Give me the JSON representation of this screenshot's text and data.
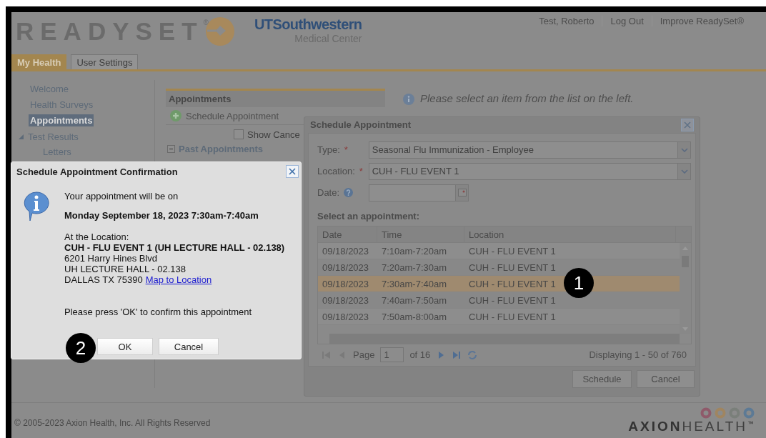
{
  "header": {
    "logo_text": "READYSET",
    "logo_mark": "®",
    "partner_name": "UTSouthwestern",
    "partner_sub": "Medical Center",
    "user_links": [
      "Test, Roberto",
      "Log Out",
      "Improve ReadySet®"
    ]
  },
  "tabs": [
    {
      "label": "My Health",
      "selected": true
    },
    {
      "label": "User Settings",
      "selected": false
    }
  ],
  "sidebar": {
    "items": [
      {
        "label": "Welcome",
        "selected": false
      },
      {
        "label": "Health Surveys",
        "selected": false
      },
      {
        "label": "Appointments",
        "selected": true
      },
      {
        "label": "Test Results",
        "selected": false,
        "expanded": true,
        "children": [
          {
            "label": "Letters",
            "selected": false
          }
        ]
      }
    ]
  },
  "appointments_panel": {
    "title": "Appointments",
    "action": "Schedule Appointment",
    "show_cancelled": {
      "label": "Show Cance",
      "checked": false
    },
    "section": {
      "label": "Past Appointments",
      "expanded": true
    }
  },
  "info_message": "Please select an item from the list on the left.",
  "schedule_dialog": {
    "title": "Schedule Appointment",
    "fields": [
      {
        "label": "Type:",
        "required_mark": "*",
        "kind": "select",
        "value": "Seasonal Flu Immunization - Employee"
      },
      {
        "label": "Location:",
        "required_mark": "*",
        "kind": "select",
        "value": "CUH - FLU EVENT 1"
      },
      {
        "label": "Date:",
        "kind": "date",
        "help": true
      }
    ],
    "grid_title": "Select an appointment:",
    "columns": [
      "Date",
      "Time",
      "Location"
    ],
    "rows": [
      {
        "cells": [
          "09/18/2023",
          "7:10am-7:20am",
          "CUH - FLU EVENT 1"
        ],
        "selected": false
      },
      {
        "cells": [
          "09/18/2023",
          "7:20am-7:30am",
          "CUH - FLU EVENT 1"
        ],
        "selected": false
      },
      {
        "cells": [
          "09/18/2023",
          "7:30am-7:40am",
          "CUH - FLU EVENT 1"
        ],
        "selected": true
      },
      {
        "cells": [
          "09/18/2023",
          "7:40am-7:50am",
          "CUH - FLU EVENT 1"
        ],
        "selected": false
      },
      {
        "cells": [
          "09/18/2023",
          "7:50am-8:00am",
          "CUH - FLU EVENT 1"
        ],
        "selected": false
      }
    ],
    "pager": {
      "page_label": "Page",
      "page": "1",
      "of": "of 16",
      "display": "Displaying 1 - 50 of 760"
    },
    "buttons": [
      "Schedule",
      "Cancel"
    ]
  },
  "confirm_dialog": {
    "title": "Schedule Appointment Confirmation",
    "intro": "Your appointment will be on",
    "when": "Monday September 18, 2023 7:30am-7:40am",
    "location_label": "At the Location:",
    "location_name": "CUH - FLU EVENT 1 (UH LECTURE HALL - 02.138)",
    "address_lines": [
      "6201 Harry Hines Blvd",
      "UH LECTURE HALL - 02.138",
      "DALLAS TX 75390"
    ],
    "map_link": "Map to Location",
    "prompt": "Please press 'OK' to confirm this appointment",
    "buttons": [
      "OK",
      "Cancel"
    ]
  },
  "callouts": [
    "1",
    "2"
  ],
  "footer": {
    "copyright": "© 2005-2023 Axion Health, Inc. All Rights Reserved",
    "brand_bold": "AXION",
    "brand_light": "HEALTH",
    "brand_mark": "™"
  }
}
